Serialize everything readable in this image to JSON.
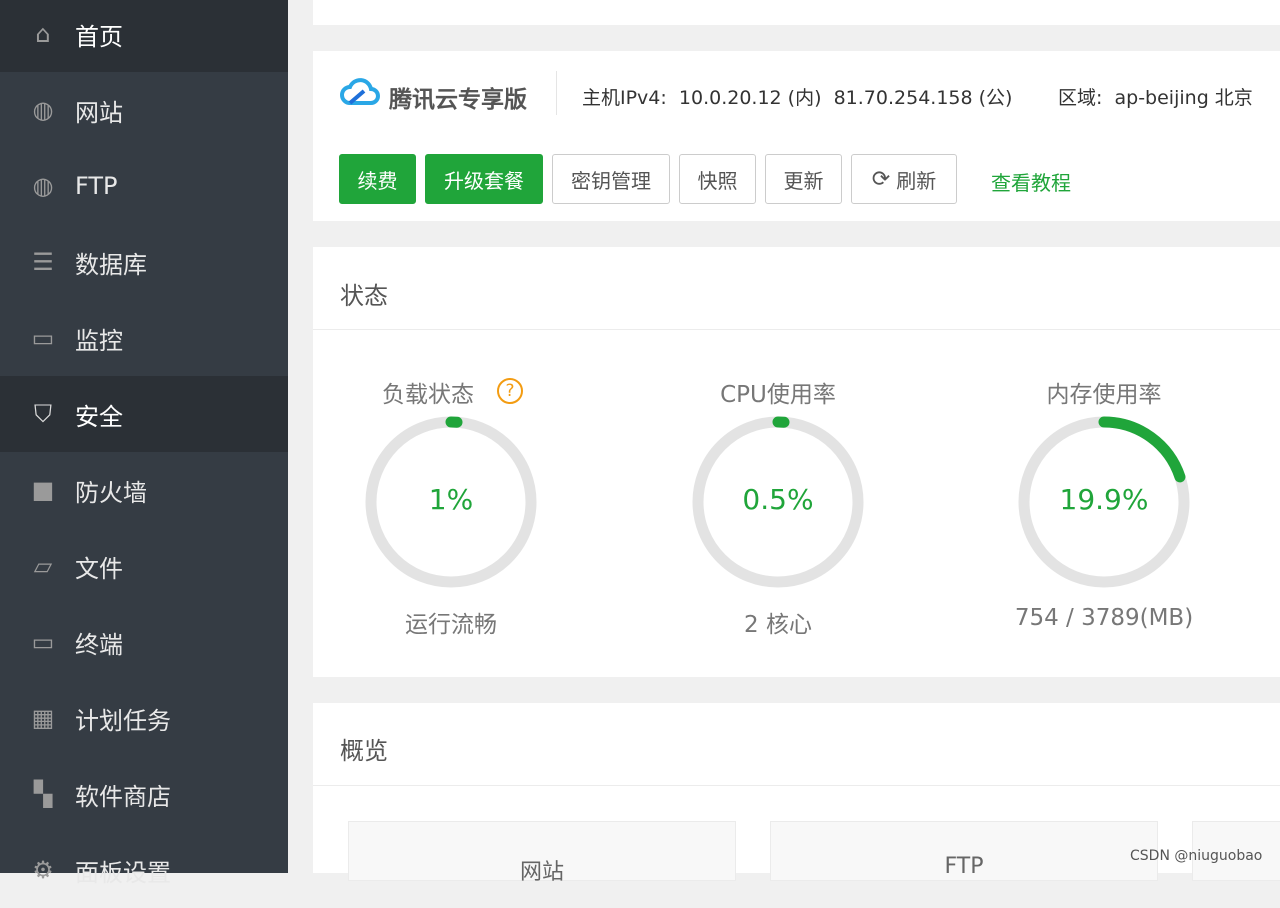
{
  "sidebar": {
    "items": [
      {
        "label": "首页",
        "icon": "home-icon"
      },
      {
        "label": "网站",
        "icon": "globe-icon"
      },
      {
        "label": "FTP",
        "icon": "ftp-icon"
      },
      {
        "label": "数据库",
        "icon": "database-icon"
      },
      {
        "label": "监控",
        "icon": "monitor-icon"
      },
      {
        "label": "安全",
        "icon": "shield-icon"
      },
      {
        "label": "防火墙",
        "icon": "firewall-icon"
      },
      {
        "label": "文件",
        "icon": "folder-icon"
      },
      {
        "label": "终端",
        "icon": "terminal-icon"
      },
      {
        "label": "计划任务",
        "icon": "calendar-icon"
      },
      {
        "label": "软件商店",
        "icon": "apps-icon"
      },
      {
        "label": "面板设置",
        "icon": "gear-icon"
      }
    ],
    "active": "安全"
  },
  "server": {
    "brand": "腾讯云专享版",
    "ip_label": "主机IPv4:",
    "ip_internal": "10.0.20.12 (内)",
    "ip_public": "81.70.254.158 (公)",
    "region_label": "区域:",
    "region": "ap-beijing 北京"
  },
  "actions": {
    "renew": "续费",
    "upgrade": "升级套餐",
    "keys": "密钥管理",
    "snapshot": "快照",
    "update": "更新",
    "refresh": "刷新",
    "tutorial": "查看教程"
  },
  "status": {
    "title": "状态",
    "gauges": [
      {
        "title": "负载状态",
        "value": "1%",
        "percent": 1,
        "sub": "运行流畅"
      },
      {
        "title": "CPU使用率",
        "value": "0.5%",
        "percent": 0.5,
        "sub": "2 核心"
      },
      {
        "title": "内存使用率",
        "value": "19.9%",
        "percent": 19.9,
        "sub": "754 / 3789(MB)"
      }
    ]
  },
  "overview": {
    "title": "概览",
    "boxes": [
      "网站",
      "FTP"
    ]
  },
  "colors": {
    "accent": "#20a53a",
    "sidebar": "#353c44"
  },
  "watermark": "CSDN @niuguobao"
}
